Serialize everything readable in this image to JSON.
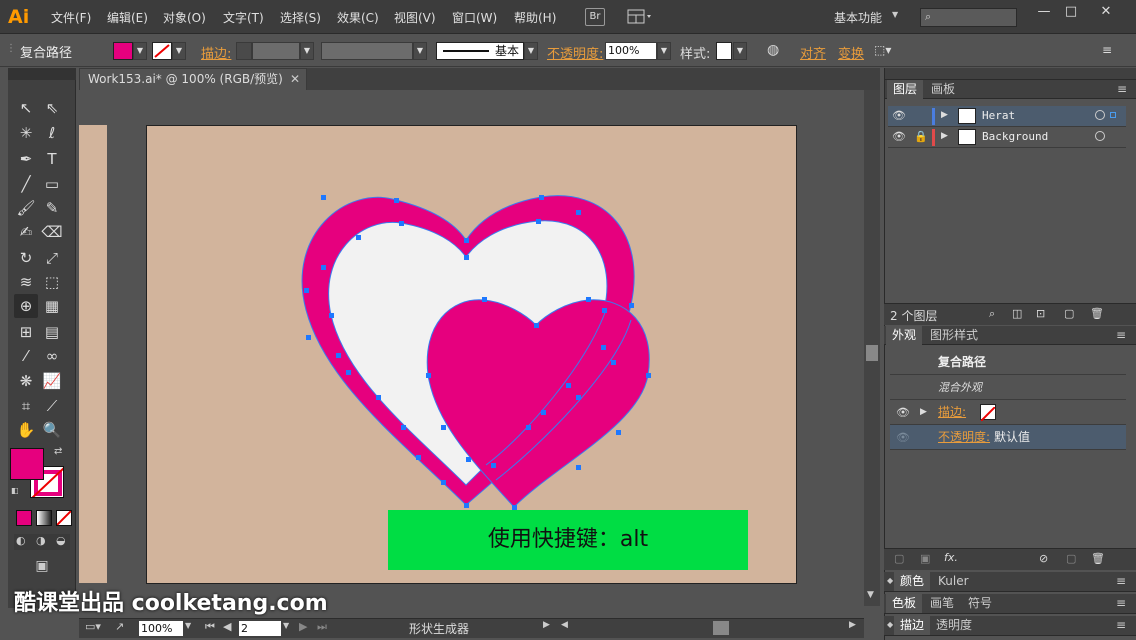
{
  "app": {
    "logo": "Ai",
    "workspace": "基本功能",
    "bridge": "Br"
  },
  "menu": [
    "文件(F)",
    "编辑(E)",
    "对象(O)",
    "文字(T)",
    "选择(S)",
    "效果(C)",
    "视图(V)",
    "窗口(W)",
    "帮助(H)"
  ],
  "control": {
    "selection": "复合路径",
    "stroke_label": "描边:",
    "stroke_style": "基本",
    "opacity_label": "不透明度:",
    "opacity_value": "100%",
    "style_label": "样式:",
    "align_label": "对齐",
    "transform_label": "变换"
  },
  "document": {
    "tab_title": "Work153.ai* @ 100% (RGB/预览)"
  },
  "canvas": {
    "hint": "使用快捷键：alt"
  },
  "status": {
    "zoom": "100%",
    "artboard": "2",
    "tool_name": "形状生成器"
  },
  "watermark": "酷课堂出品 coolketang.com",
  "layers_panel": {
    "tabs": [
      "图层",
      "画板"
    ],
    "layers": [
      {
        "name": "Herat",
        "color": "#4a7de0",
        "selected": true
      },
      {
        "name": "Background",
        "color": "#e04a4a",
        "selected": false
      }
    ],
    "count": "2 个图层"
  },
  "appearance_panel": {
    "tabs": [
      "外观",
      "图形样式"
    ],
    "title": "复合路径",
    "subtitle": "混合外观",
    "stroke_label": "描边:",
    "opacity_label": "不透明度:",
    "opacity_value": "默认值"
  },
  "collapsed_panels": {
    "row1": [
      "颜色",
      "Kuler"
    ],
    "row2": [
      "色板",
      "画笔",
      "符号"
    ],
    "row3": [
      "描边",
      "透明度"
    ]
  },
  "colors": {
    "fill": "#e6007e",
    "artboard": "#d2b49c",
    "heart_inner": "#f2f2f2",
    "hint_bg": "#00dd44",
    "anchor": "#1e78ff",
    "accent": "#e89c3c"
  }
}
